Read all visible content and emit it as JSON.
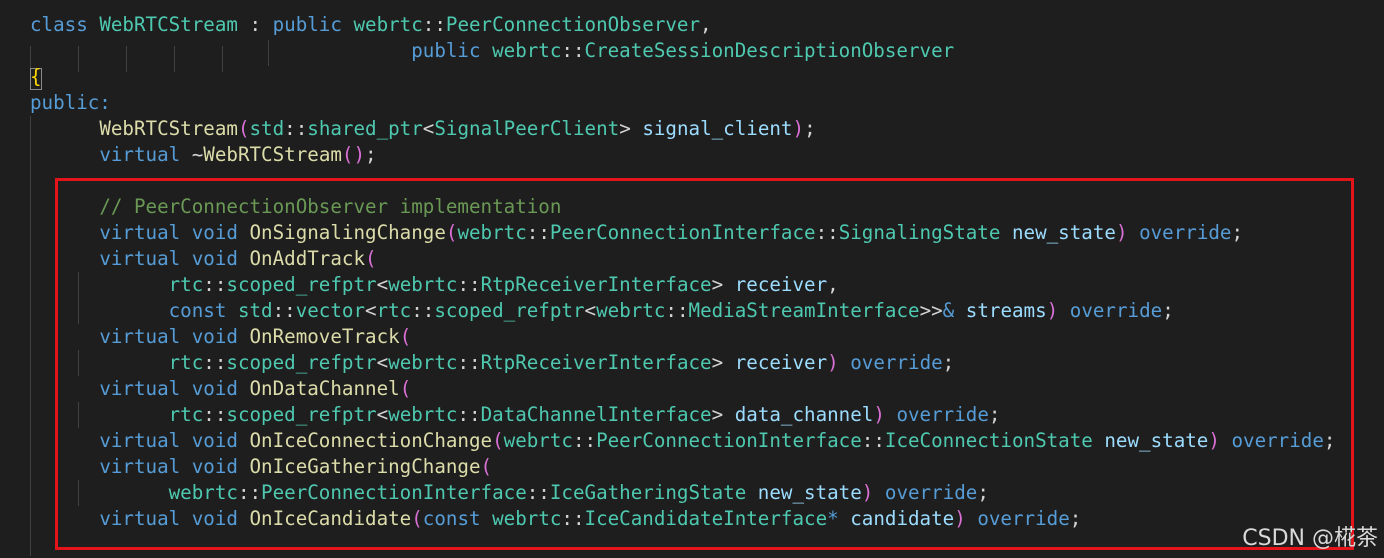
{
  "colors": {
    "background": "#1e1e1e",
    "keyword": "#569cd6",
    "type": "#4ec9b0",
    "function": "#dcdcaa",
    "variable": "#9cdcfe",
    "plain": "#d4d4d4",
    "comment": "#6a9955",
    "paren": "#da70d6",
    "brace": "#ffd700",
    "highlight_border": "#e3151a"
  },
  "code_lines": [
    [
      {
        "t": "class ",
        "c": "keyword"
      },
      {
        "t": "WebRTCStream",
        "c": "type"
      },
      {
        "t": " : ",
        "c": "plain"
      },
      {
        "t": "public ",
        "c": "keyword"
      },
      {
        "t": "webrtc",
        "c": "type"
      },
      {
        "t": "::",
        "c": "plain"
      },
      {
        "t": "PeerConnectionObserver",
        "c": "type"
      },
      {
        "t": ",",
        "c": "plain"
      }
    ],
    [
      {
        "t": "                                 ",
        "c": "plain"
      },
      {
        "t": "public ",
        "c": "keyword"
      },
      {
        "t": "webrtc",
        "c": "type"
      },
      {
        "t": "::",
        "c": "plain"
      },
      {
        "t": "CreateSessionDescriptionObserver",
        "c": "type"
      }
    ],
    [
      {
        "t": "{",
        "c": "brace"
      }
    ],
    [
      {
        "t": "public:",
        "c": "keyword"
      }
    ],
    [
      {
        "t": "      ",
        "c": "plain"
      },
      {
        "t": "WebRTCStream",
        "c": "function"
      },
      {
        "t": "(",
        "c": "paren"
      },
      {
        "t": "std",
        "c": "type"
      },
      {
        "t": "::",
        "c": "plain"
      },
      {
        "t": "shared_ptr",
        "c": "type"
      },
      {
        "t": "<",
        "c": "plain"
      },
      {
        "t": "SignalPeerClient",
        "c": "type"
      },
      {
        "t": "> ",
        "c": "plain"
      },
      {
        "t": "signal_client",
        "c": "variable"
      },
      {
        "t": ")",
        "c": "paren"
      },
      {
        "t": ";",
        "c": "plain"
      }
    ],
    [
      {
        "t": "      ",
        "c": "plain"
      },
      {
        "t": "virtual ",
        "c": "keyword"
      },
      {
        "t": "~",
        "c": "plain"
      },
      {
        "t": "WebRTCStream",
        "c": "function"
      },
      {
        "t": "()",
        "c": "paren"
      },
      {
        "t": ";",
        "c": "plain"
      }
    ],
    [],
    [
      {
        "t": "      ",
        "c": "plain"
      },
      {
        "t": "// PeerConnectionObserver implementation",
        "c": "comment"
      }
    ],
    [
      {
        "t": "      ",
        "c": "plain"
      },
      {
        "t": "virtual ",
        "c": "keyword"
      },
      {
        "t": "void ",
        "c": "keyword"
      },
      {
        "t": "OnSignalingChange",
        "c": "function"
      },
      {
        "t": "(",
        "c": "paren"
      },
      {
        "t": "webrtc",
        "c": "type"
      },
      {
        "t": "::",
        "c": "plain"
      },
      {
        "t": "PeerConnectionInterface",
        "c": "type"
      },
      {
        "t": "::",
        "c": "plain"
      },
      {
        "t": "SignalingState",
        "c": "type"
      },
      {
        "t": " new_state",
        "c": "variable"
      },
      {
        "t": ")",
        "c": "paren"
      },
      {
        "t": " override",
        "c": "keyword"
      },
      {
        "t": ";",
        "c": "plain"
      }
    ],
    [
      {
        "t": "      ",
        "c": "plain"
      },
      {
        "t": "virtual ",
        "c": "keyword"
      },
      {
        "t": "void ",
        "c": "keyword"
      },
      {
        "t": "OnAddTrack",
        "c": "function"
      },
      {
        "t": "(",
        "c": "paren"
      }
    ],
    [
      {
        "t": "            ",
        "c": "plain"
      },
      {
        "t": "rtc",
        "c": "type"
      },
      {
        "t": "::",
        "c": "plain"
      },
      {
        "t": "scoped_refptr",
        "c": "type"
      },
      {
        "t": "<",
        "c": "plain"
      },
      {
        "t": "webrtc",
        "c": "type"
      },
      {
        "t": "::",
        "c": "plain"
      },
      {
        "t": "RtpReceiverInterface",
        "c": "type"
      },
      {
        "t": "> ",
        "c": "plain"
      },
      {
        "t": "receiver",
        "c": "variable"
      },
      {
        "t": ",",
        "c": "plain"
      }
    ],
    [
      {
        "t": "            ",
        "c": "plain"
      },
      {
        "t": "const ",
        "c": "keyword"
      },
      {
        "t": "std",
        "c": "type"
      },
      {
        "t": "::",
        "c": "plain"
      },
      {
        "t": "vector",
        "c": "type"
      },
      {
        "t": "<",
        "c": "plain"
      },
      {
        "t": "rtc",
        "c": "type"
      },
      {
        "t": "::",
        "c": "plain"
      },
      {
        "t": "scoped_refptr",
        "c": "type"
      },
      {
        "t": "<",
        "c": "plain"
      },
      {
        "t": "webrtc",
        "c": "type"
      },
      {
        "t": "::",
        "c": "plain"
      },
      {
        "t": "MediaStreamInterface",
        "c": "type"
      },
      {
        "t": ">>",
        "c": "plain"
      },
      {
        "t": "&",
        "c": "keyword"
      },
      {
        "t": " streams",
        "c": "variable"
      },
      {
        "t": ")",
        "c": "paren"
      },
      {
        "t": " override",
        "c": "keyword"
      },
      {
        "t": ";",
        "c": "plain"
      }
    ],
    [
      {
        "t": "      ",
        "c": "plain"
      },
      {
        "t": "virtual ",
        "c": "keyword"
      },
      {
        "t": "void ",
        "c": "keyword"
      },
      {
        "t": "OnRemoveTrack",
        "c": "function"
      },
      {
        "t": "(",
        "c": "paren"
      }
    ],
    [
      {
        "t": "            ",
        "c": "plain"
      },
      {
        "t": "rtc",
        "c": "type"
      },
      {
        "t": "::",
        "c": "plain"
      },
      {
        "t": "scoped_refptr",
        "c": "type"
      },
      {
        "t": "<",
        "c": "plain"
      },
      {
        "t": "webrtc",
        "c": "type"
      },
      {
        "t": "::",
        "c": "plain"
      },
      {
        "t": "RtpReceiverInterface",
        "c": "type"
      },
      {
        "t": "> ",
        "c": "plain"
      },
      {
        "t": "receiver",
        "c": "variable"
      },
      {
        "t": ")",
        "c": "paren"
      },
      {
        "t": " override",
        "c": "keyword"
      },
      {
        "t": ";",
        "c": "plain"
      }
    ],
    [
      {
        "t": "      ",
        "c": "plain"
      },
      {
        "t": "virtual ",
        "c": "keyword"
      },
      {
        "t": "void ",
        "c": "keyword"
      },
      {
        "t": "OnDataChannel",
        "c": "function"
      },
      {
        "t": "(",
        "c": "paren"
      }
    ],
    [
      {
        "t": "            ",
        "c": "plain"
      },
      {
        "t": "rtc",
        "c": "type"
      },
      {
        "t": "::",
        "c": "plain"
      },
      {
        "t": "scoped_refptr",
        "c": "type"
      },
      {
        "t": "<",
        "c": "plain"
      },
      {
        "t": "webrtc",
        "c": "type"
      },
      {
        "t": "::",
        "c": "plain"
      },
      {
        "t": "DataChannelInterface",
        "c": "type"
      },
      {
        "t": "> ",
        "c": "plain"
      },
      {
        "t": "data_channel",
        "c": "variable"
      },
      {
        "t": ")",
        "c": "paren"
      },
      {
        "t": " override",
        "c": "keyword"
      },
      {
        "t": ";",
        "c": "plain"
      }
    ],
    [
      {
        "t": "      ",
        "c": "plain"
      },
      {
        "t": "virtual ",
        "c": "keyword"
      },
      {
        "t": "void ",
        "c": "keyword"
      },
      {
        "t": "OnIceConnectionChange",
        "c": "function"
      },
      {
        "t": "(",
        "c": "paren"
      },
      {
        "t": "webrtc",
        "c": "type"
      },
      {
        "t": "::",
        "c": "plain"
      },
      {
        "t": "PeerConnectionInterface",
        "c": "type"
      },
      {
        "t": "::",
        "c": "plain"
      },
      {
        "t": "IceConnectionState",
        "c": "type"
      },
      {
        "t": " new_state",
        "c": "variable"
      },
      {
        "t": ")",
        "c": "paren"
      },
      {
        "t": " override",
        "c": "keyword"
      },
      {
        "t": ";",
        "c": "plain"
      }
    ],
    [
      {
        "t": "      ",
        "c": "plain"
      },
      {
        "t": "virtual ",
        "c": "keyword"
      },
      {
        "t": "void ",
        "c": "keyword"
      },
      {
        "t": "OnIceGatheringChange",
        "c": "function"
      },
      {
        "t": "(",
        "c": "paren"
      }
    ],
    [
      {
        "t": "            ",
        "c": "plain"
      },
      {
        "t": "webrtc",
        "c": "type"
      },
      {
        "t": "::",
        "c": "plain"
      },
      {
        "t": "PeerConnectionInterface",
        "c": "type"
      },
      {
        "t": "::",
        "c": "plain"
      },
      {
        "t": "IceGatheringState",
        "c": "type"
      },
      {
        "t": " new_state",
        "c": "variable"
      },
      {
        "t": ")",
        "c": "paren"
      },
      {
        "t": " override",
        "c": "keyword"
      },
      {
        "t": ";",
        "c": "plain"
      }
    ],
    [
      {
        "t": "      ",
        "c": "plain"
      },
      {
        "t": "virtual ",
        "c": "keyword"
      },
      {
        "t": "void ",
        "c": "keyword"
      },
      {
        "t": "OnIceCandidate",
        "c": "function"
      },
      {
        "t": "(",
        "c": "paren"
      },
      {
        "t": "const ",
        "c": "keyword"
      },
      {
        "t": "webrtc",
        "c": "type"
      },
      {
        "t": "::",
        "c": "plain"
      },
      {
        "t": "IceCandidateInterface",
        "c": "type"
      },
      {
        "t": "*",
        "c": "keyword"
      },
      {
        "t": " candidate",
        "c": "variable"
      },
      {
        "t": ")",
        "c": "paren"
      },
      {
        "t": " override",
        "c": "keyword"
      },
      {
        "t": ";",
        "c": "plain"
      }
    ]
  ],
  "watermark": "CSDN @椛茶"
}
